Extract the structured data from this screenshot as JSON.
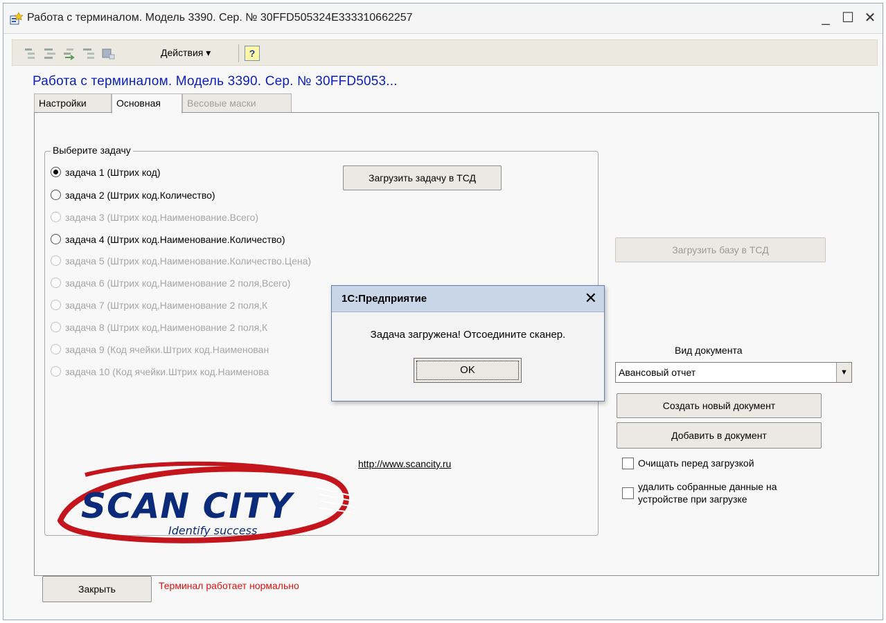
{
  "window": {
    "title": "Работа с терминалом. Модель 3390. Сер. № 30FFD505324E333310662257",
    "controls": {
      "minimize": "_",
      "maximize": "☐",
      "close": "✕"
    }
  },
  "toolbar": {
    "icons": [
      "tree-level-icon",
      "tree-expand-icon",
      "tree-move-icon",
      "tree-collapse-icon",
      "record-icon"
    ],
    "actions_label": "Действия ▾",
    "help_label": "?"
  },
  "form_title": "Работа с терминалом. Модель 3390. Сер. № 30FFD5053...",
  "tabs": [
    {
      "label": "Настройки",
      "state": "normal"
    },
    {
      "label": "Основная",
      "state": "active"
    },
    {
      "label": "Весовые маски",
      "state": "disabled"
    }
  ],
  "task_group": {
    "title": "Выберите задачу",
    "tasks": [
      {
        "label": "задача 1 (Штрих код)",
        "checked": true,
        "enabled": true
      },
      {
        "label": "задача 2 (Штрих код.Количество)",
        "checked": false,
        "enabled": true
      },
      {
        "label": "задача 3 (Штрих код.Наименование.Всего)",
        "checked": false,
        "enabled": false
      },
      {
        "label": "задача 4 (Штрих код.Наименование.Количество)",
        "checked": false,
        "enabled": true
      },
      {
        "label": "задача 5 (Штрих код.Наименование.Количество.Цена)",
        "checked": false,
        "enabled": false
      },
      {
        "label": "задача 6 (Штрих код,Наименование 2 поля,Всего)",
        "checked": false,
        "enabled": false
      },
      {
        "label": "задача 7 (Штрих код,Наименование 2 поля,К",
        "checked": false,
        "enabled": false
      },
      {
        "label": "задача 8 (Штрих код,Наименование 2 поля,К",
        "checked": false,
        "enabled": false
      },
      {
        "label": "задача 9 (Код ячейки.Штрих код.Наименован",
        "checked": false,
        "enabled": false
      },
      {
        "label": "задача 10 (Код ячейки.Штрих код.Наименова",
        "checked": false,
        "enabled": false
      }
    ],
    "load_task_button": "Загрузить задачу в ТСД",
    "logo": {
      "name": "SCAN CITY",
      "tagline": "Identify success"
    },
    "link": "http://www.scancity.ru"
  },
  "right_panel": {
    "load_base_button": "Загрузить базу в ТСД",
    "doc_type_label": "Вид документа",
    "doc_type_value": "Авансовый отчет",
    "create_button": "Создать новый документ",
    "add_button": "Добавить в документ",
    "checkbox_clear": "Очищать перед загрузкой",
    "checkbox_delete_line1": "удалить собранные данные на",
    "checkbox_delete_line2": "устройстве при загрузке"
  },
  "footer": {
    "close_button": "Закрыть",
    "status_text": "Терминал работает нормально",
    "status_color": "#e01010"
  },
  "dialog": {
    "title": "1С:Предприятие",
    "close": "✕",
    "message": "Задача загружена! Отсоедините сканер.",
    "ok_label": "OK"
  },
  "colors": {
    "title_blue": "#0a1fc0",
    "logo_navy": "#0b2a7a",
    "logo_red": "#c4141c"
  }
}
